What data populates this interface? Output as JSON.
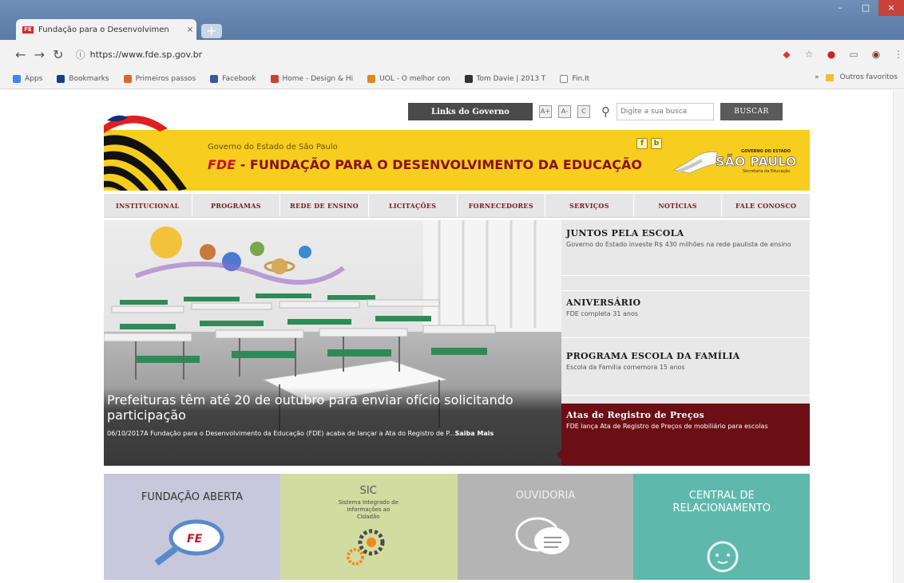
{
  "browser": {
    "tab_title": "Fundação para o Desenvolvimen",
    "tab_close": "×",
    "new_tab": "+",
    "url": "https://www.fde.sp.gov.br",
    "bookmarks": [
      {
        "label": "Apps",
        "color": "#4285f4"
      },
      {
        "label": "Bookmarks",
        "color": "#1a3f8a"
      },
      {
        "label": "Primeiros passos",
        "color": "#e0652a"
      },
      {
        "label": "Facebook",
        "color": "#3b5998"
      },
      {
        "label": "Home - Design & Hi",
        "color": "#d04030"
      },
      {
        "label": "UOL - O melhor con",
        "color": "#e08a1e"
      },
      {
        "label": "Tom Davie | 2013 T",
        "color": "#333333"
      },
      {
        "label": "Fin.It",
        "color": "#888888"
      }
    ],
    "other_bookmarks": "Outros favoritos"
  },
  "site": {
    "gov_links": "Links do Governo",
    "acc_plus": "A+",
    "acc_minus": "A-",
    "acc_contrast": "C",
    "search_placeholder": "Digite a sua busca",
    "search_button": "BUSCAR",
    "gov_line": "Governo do Estado de São Paulo",
    "fde_mark": "FDE",
    "fde_title": " - FUNDAÇÃO PARA O DESENVOLVIMENTO DA EDUCAÇÃO",
    "social_f": "f",
    "social_b": "b",
    "sp_small": "GOVERNO DO ESTADO",
    "sp_big": "SÃO PAULO",
    "sp_sub": "Secretaria da Educação"
  },
  "nav": [
    "INSTITUCIONAL",
    "PROGRAMAS",
    "REDE DE ENSINO",
    "LICITAÇÕES",
    "FORNECEDORES",
    "SERVIÇOS",
    "NOTÍCIAS",
    "FALE CONOSCO"
  ],
  "hero": {
    "title": "Prefeituras têm até 20 de outubro para enviar ofício solicitando participação",
    "text": "06/10/2017A Fundação para o Desenvolvimento da Educação (FDE) acaba de lançar a Ata do Registro de P...",
    "more": "Saiba Mais"
  },
  "side": [
    {
      "title": "JUNTOS PELA ESCOLA",
      "text": "Governo do Estado investe R$ 430 milhões na rede paulista de ensino"
    },
    {
      "title": "ANIVERSÁRIO",
      "text": "FDE completa 31 anos"
    },
    {
      "title": "PROGRAMA ESCOLA DA FAMÍLIA",
      "text": "Escola da Família comemora 15 anos"
    }
  ],
  "side_highlight": {
    "title": "Atas de Registro de Preços",
    "text": "FDE lança Ata de Registro de Preços de mobiliário para escolas"
  },
  "tiles": [
    {
      "title": "FUNDAÇÃO ABERTA",
      "sub": ""
    },
    {
      "title": "SIC",
      "sub": "Sistema Integrado de Informações ao Cidadão"
    },
    {
      "title": "OUVIDORIA",
      "sub": ""
    },
    {
      "title": "CENTRAL DE RELACIONAMENTO",
      "sub": ""
    }
  ],
  "icons": {
    "back": "back-arrow-icon",
    "forward": "forward-arrow-icon",
    "reload": "reload-icon",
    "info": "info-icon",
    "star": "star-icon",
    "search": "magnifier-icon"
  }
}
